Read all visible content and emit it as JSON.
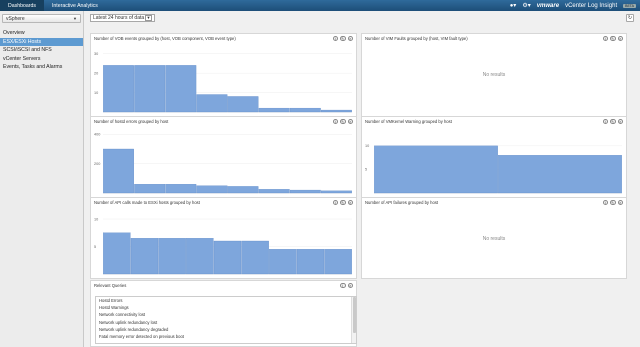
{
  "topbar": {
    "tabs": [
      {
        "label": "Dashboards",
        "active": true
      },
      {
        "label": "Interactive Analytics",
        "active": false
      }
    ],
    "user_icon": "user-icon",
    "settings_icon": "gear-icon",
    "brand": "vmware",
    "product": "vCenter Log Insight",
    "badge": "BETA"
  },
  "sidebar": {
    "select_value": "vSphere",
    "items": [
      {
        "label": "Overview",
        "active": false
      },
      {
        "label": "ESX/ESXi Hosts",
        "active": true
      },
      {
        "label": "SCSI/iSCSI and NFS",
        "active": false
      },
      {
        "label": "vCenter Servers",
        "active": false
      },
      {
        "label": "Events, Tasks and Alarms",
        "active": false
      }
    ]
  },
  "toolbar": {
    "time_range": "Latest 24 hours of data",
    "refresh_icon": "refresh-icon"
  },
  "colors": {
    "bar": "#7ea6dc",
    "bar_stroke": "#5b86c4",
    "active": "#5d9ad1",
    "topbar": "#1d4e78"
  },
  "panels": {
    "vob": {
      "title": "Number of VOB events grouped by (host, VOB component, VOB event type)"
    },
    "vim": {
      "title": "Number of VIM Faults grouped by (host, VIM fault type)",
      "empty": "No results"
    },
    "hostd": {
      "title": "Number of hostd errors grouped by host"
    },
    "vmkernel": {
      "title": "Number of VMKernel Warning grouped by host"
    },
    "api_calls": {
      "title": "Number of API calls made to ESXi hosts grouped by host"
    },
    "api_failures": {
      "title": "Number of API failures grouped by host",
      "empty": "No results"
    },
    "relevant": {
      "title": "Relevant Queries",
      "items": [
        "Hostd Errors",
        "Hostd Warnings",
        "Network connectivity lost",
        "Network uplink redundancy lost",
        "Network uplink redundancy degraded",
        "Fatal memory error detected on previous boot"
      ]
    }
  },
  "chart_data": [
    {
      "type": "bar",
      "title": "Number of VOB events grouped by (host, VOB component, VOB event type)",
      "ylim": [
        0,
        35
      ],
      "yticks": [
        10,
        20,
        30
      ],
      "values": [
        24,
        24,
        24,
        9,
        8,
        2,
        2,
        1
      ]
    },
    {
      "type": "bar",
      "title": "Number of hostd errors grouped by host",
      "ylim": [
        0,
        450
      ],
      "yticks": [
        200,
        400
      ],
      "values": [
        300,
        60,
        60,
        50,
        45,
        25,
        20,
        15
      ]
    },
    {
      "type": "bar",
      "title": "Number of VMKernel Warning grouped by host",
      "ylim": [
        0,
        14
      ],
      "yticks": [
        5,
        10
      ],
      "values": [
        10,
        8
      ]
    },
    {
      "type": "bar",
      "title": "Number of API calls made to ESXi hosts grouped by host",
      "ylim": [
        0,
        12
      ],
      "yticks": [
        5,
        10
      ],
      "values": [
        7.5,
        6.5,
        6.5,
        6.5,
        6,
        6,
        4.5,
        4.5,
        4.5
      ]
    }
  ]
}
